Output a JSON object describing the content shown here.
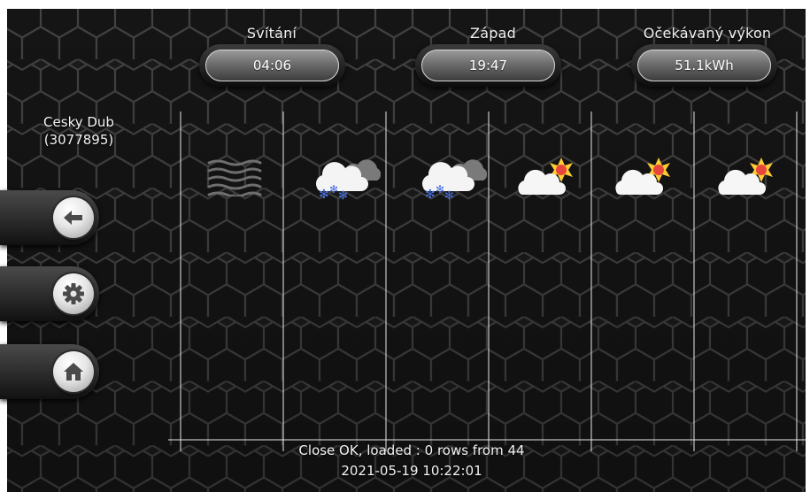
{
  "header": {
    "sunrise": {
      "label": "Svítání",
      "value": "04:06"
    },
    "sunset": {
      "label": "Západ",
      "value": "19:47"
    },
    "expected_output": {
      "label": "Očekávaný výkon",
      "value": "51.1kWh"
    }
  },
  "location": {
    "name": "Cesky Dub",
    "id": "(3077895)"
  },
  "side_buttons": [
    {
      "name": "back-button",
      "icon": "arrow-left-icon"
    },
    {
      "name": "settings-button",
      "icon": "gear-icon"
    },
    {
      "name": "home-button",
      "icon": "home-icon"
    }
  ],
  "forecast_icons": [
    "fog-icon",
    "snow-cloud-icon",
    "snow-cloud-icon",
    "sun-behind-cloud-icon",
    "sun-behind-cloud-icon",
    "sun-behind-cloud-icon"
  ],
  "status": {
    "message": "Close OK, loaded : 0 rows from 44",
    "timestamp": "2021-05-19 10:22:01"
  },
  "colors": {
    "background": "#1b1b1b",
    "hex_stroke": "#3a3a3a",
    "grid_line": "#ffffff",
    "sun": "#ffcc33",
    "sun_core": "#e8453c"
  }
}
